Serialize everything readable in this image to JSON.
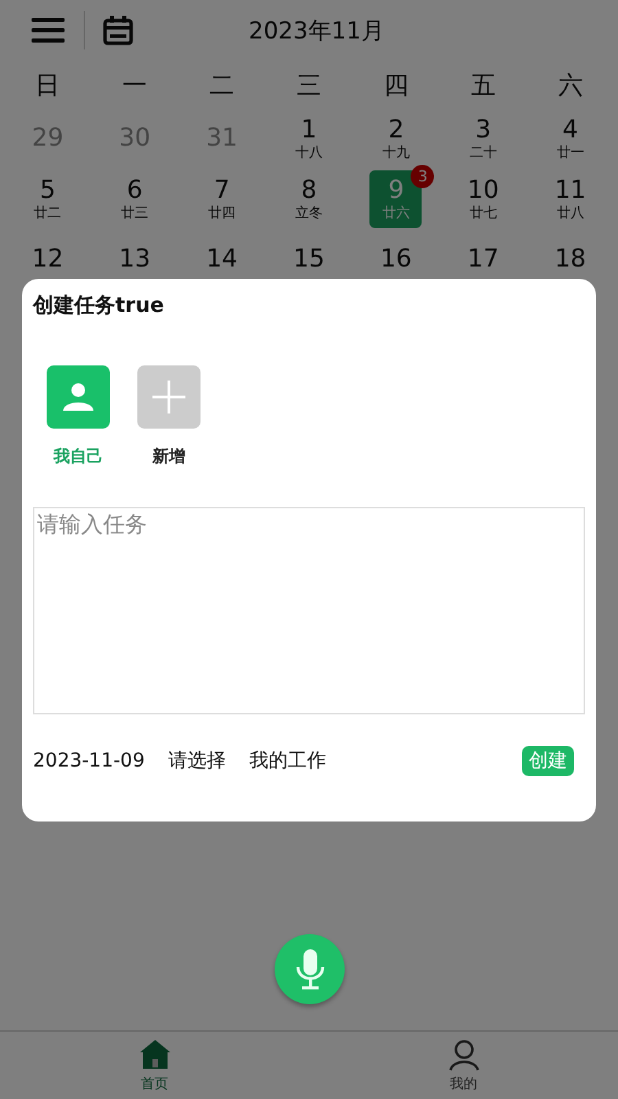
{
  "header": {
    "title": "2023年11月"
  },
  "weekdays": [
    "日",
    "一",
    "二",
    "三",
    "四",
    "五",
    "六"
  ],
  "days": [
    {
      "day": "29",
      "outside": true,
      "selected": false
    },
    {
      "day": "30",
      "outside": true,
      "selected": false
    },
    {
      "day": "31",
      "outside": true,
      "selected": false
    },
    {
      "day": "1",
      "lunar": "十八",
      "outside": false,
      "selected": false
    },
    {
      "day": "2",
      "lunar": "十九",
      "outside": false,
      "selected": false
    },
    {
      "day": "3",
      "lunar": "二十",
      "outside": false,
      "selected": false
    },
    {
      "day": "4",
      "lunar": "廿一",
      "outside": false,
      "selected": false
    },
    {
      "day": "5",
      "lunar": "廿二",
      "outside": false,
      "selected": false
    },
    {
      "day": "6",
      "lunar": "廿三",
      "outside": false,
      "selected": false
    },
    {
      "day": "7",
      "lunar": "廿四",
      "outside": false,
      "selected": false
    },
    {
      "day": "8",
      "lunar": "立冬",
      "outside": false,
      "selected": false
    },
    {
      "day": "9",
      "lunar": "廿六",
      "outside": false,
      "selected": true,
      "badge": "3"
    },
    {
      "day": "10",
      "lunar": "廿七",
      "outside": false,
      "selected": false
    },
    {
      "day": "11",
      "lunar": "廿八",
      "outside": false,
      "selected": false
    },
    {
      "day": "12",
      "outside": false,
      "selected": false
    },
    {
      "day": "13",
      "outside": false,
      "selected": false
    },
    {
      "day": "14",
      "outside": false,
      "selected": false
    },
    {
      "day": "15",
      "outside": false,
      "selected": false
    },
    {
      "day": "16",
      "outside": false,
      "selected": false
    },
    {
      "day": "17",
      "outside": false,
      "selected": false
    },
    {
      "day": "18",
      "outside": false,
      "selected": false
    }
  ],
  "dialog": {
    "title": "创建任务true",
    "assignees": [
      {
        "kind": "person",
        "label": "我自己",
        "selected": true
      },
      {
        "kind": "add",
        "label": "新增",
        "selected": false
      }
    ],
    "task_field": {
      "placeholder": "请输入任务"
    },
    "date": "2023-11-09",
    "picker": "请选择",
    "category": "我的工作",
    "create_button": "创建"
  },
  "bottom_nav": [
    {
      "kind": "home",
      "label": "首页",
      "selected": true
    },
    {
      "kind": "person",
      "label": "我的",
      "selected": false
    }
  ]
}
